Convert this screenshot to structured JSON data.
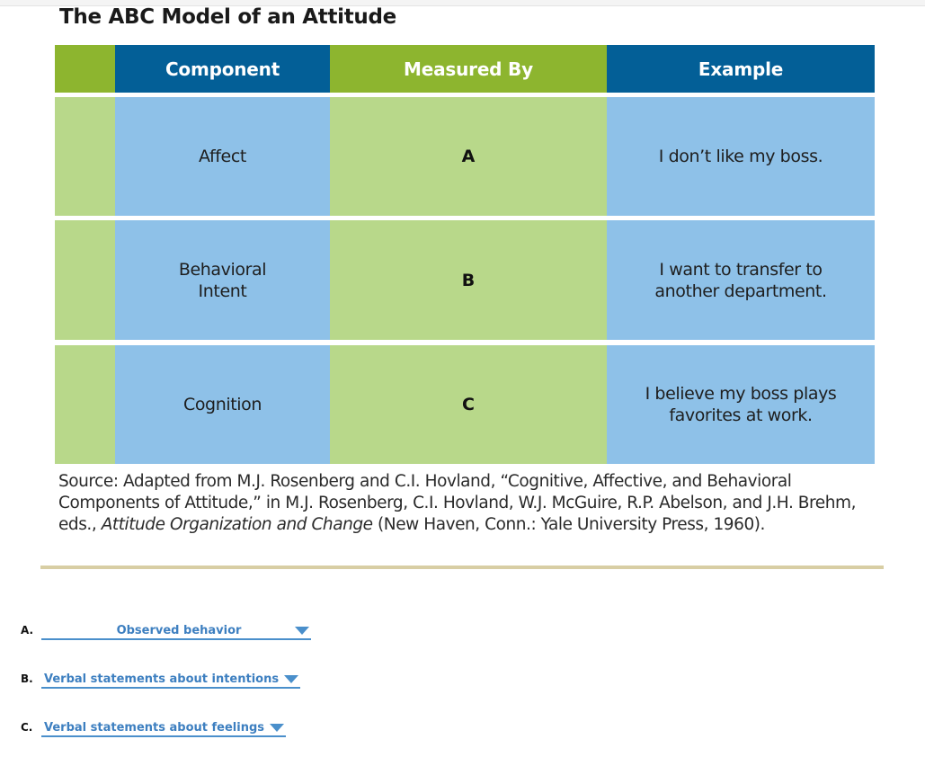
{
  "figure": {
    "title": "The ABC Model of an Attitude",
    "columns": [
      "",
      "Component",
      "Measured By",
      "Example"
    ],
    "rows": [
      {
        "component": "Affect",
        "measured_by": "A",
        "example": "I don’t like my boss."
      },
      {
        "component": "Behavioral Intent",
        "measured_by": "B",
        "example": "I want to transfer to another department."
      },
      {
        "component": "Cognition",
        "measured_by": "C",
        "example": "I believe my boss plays favorites at work."
      }
    ],
    "source_prefix": "Source: Adapted from M.J. Rosenberg and C.I. Hovland, “Cognitive, Affective, and Behavioral Components of Attitude,” in M.J. Rosenberg, C.I. Hovland, W.J. McGuire, R.P. Abelson, and J.H. Brehm, eds., ",
    "source_title": "Attitude Organization and Change",
    "source_suffix": " (New Haven, Conn.: Yale University Press, 1960).",
    "colors": {
      "header_green": "#8db52f",
      "header_blue": "#035f97",
      "cell_green": "#b8d88a",
      "cell_blue": "#8ec1e8",
      "rule_tan": "#d8cea4"
    }
  },
  "questions": [
    {
      "letter": "A.",
      "selected": "Observed behavior"
    },
    {
      "letter": "B.",
      "selected": "Verbal statements about intentions"
    },
    {
      "letter": "C.",
      "selected": "Verbal statements about feelings"
    }
  ],
  "select_color": "#3d7fc0"
}
